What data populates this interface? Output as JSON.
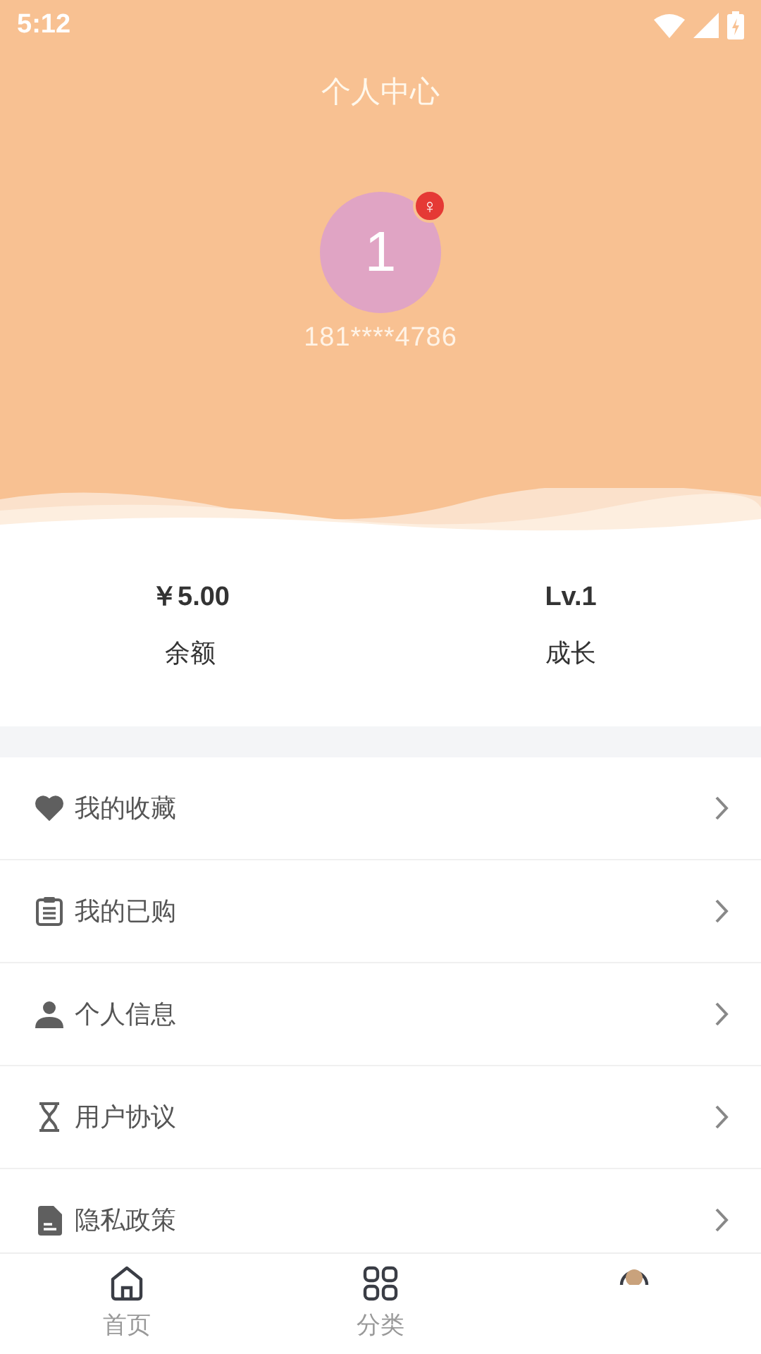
{
  "status_bar": {
    "time": "5:12"
  },
  "header": {
    "title": "个人中心",
    "avatar_text": "1",
    "gender": "♀",
    "phone": "181****4786"
  },
  "stats": [
    {
      "value": "￥5.00",
      "label": "余额"
    },
    {
      "value": "Lv.1",
      "label": "成长"
    }
  ],
  "menu": [
    {
      "kind": "heart",
      "label": "我的收藏"
    },
    {
      "kind": "clipboard",
      "label": "我的已购"
    },
    {
      "kind": "person",
      "label": "个人信息"
    },
    {
      "kind": "hourglass",
      "label": "用户协议"
    },
    {
      "kind": "document",
      "label": "隐私政策"
    }
  ],
  "tab_bar": [
    {
      "kind": "home",
      "label": "首页",
      "selected": false
    },
    {
      "kind": "grid",
      "label": "分类",
      "selected": false
    },
    {
      "kind": "profile",
      "selected": true
    }
  ]
}
